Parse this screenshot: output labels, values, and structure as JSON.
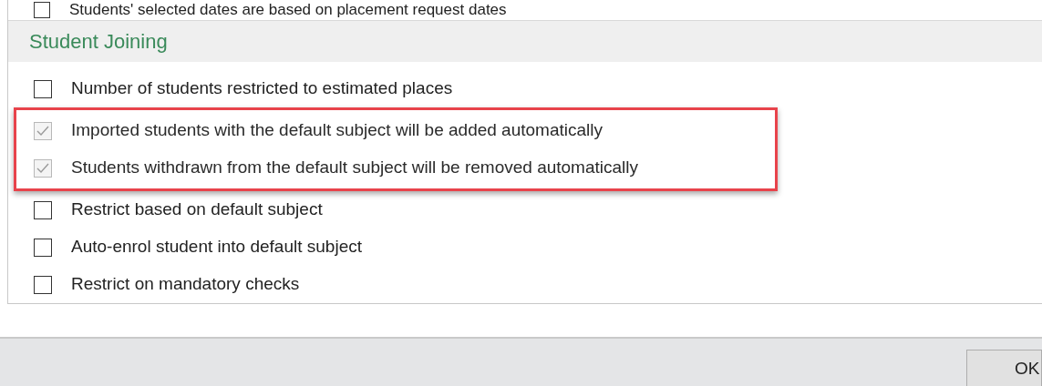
{
  "previous_option": {
    "label": "Students' selected dates are based on placement request dates",
    "checked": false
  },
  "section": {
    "title": "Student Joining"
  },
  "options": [
    {
      "label": "Number of students restricted to estimated places",
      "checked": false,
      "disabled": false,
      "highlighted": false
    },
    {
      "label": "Imported students with the default subject will be added automatically",
      "checked": true,
      "disabled": true,
      "highlighted": true
    },
    {
      "label": "Students withdrawn from the default subject will be removed automatically",
      "checked": true,
      "disabled": true,
      "highlighted": true
    },
    {
      "label": "Restrict based on default subject",
      "checked": false,
      "disabled": false,
      "highlighted": false
    },
    {
      "label": "Auto-enrol student into default subject",
      "checked": false,
      "disabled": false,
      "highlighted": false
    },
    {
      "label": "Restrict on mandatory checks",
      "checked": false,
      "disabled": false,
      "highlighted": false
    }
  ],
  "buttons": [
    {
      "label": "OK"
    }
  ]
}
